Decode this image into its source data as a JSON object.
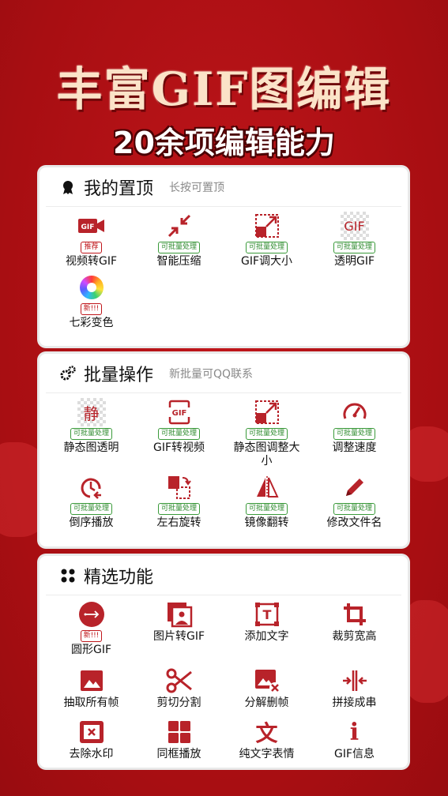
{
  "hero": {
    "title": "丰富GIF图编辑",
    "subtitle": "20余项编辑能力"
  },
  "colors": {
    "brand_red": "#c0161b",
    "icon_red": "#b8232a",
    "badge_green": "#2d8a2d",
    "background": "#b01014"
  },
  "pinned": {
    "title": "我的置顶",
    "hint": "长按可置顶",
    "items": [
      {
        "icon": "video-gif-icon",
        "badge": "推荐",
        "label": "视频转GIF"
      },
      {
        "icon": "compress-icon",
        "badge": "可批量处理",
        "label": "智能压缩"
      },
      {
        "icon": "resize-icon",
        "badge": "可批量处理",
        "label": "GIF调大小"
      },
      {
        "icon": "transparent-gif-icon",
        "icon_text": "GIF",
        "badge": "可批量处理",
        "label": "透明GIF"
      },
      {
        "icon": "color-wheel-icon",
        "badge": "新!!!",
        "label": "七彩变色"
      }
    ]
  },
  "batch": {
    "title": "批量操作",
    "hint": "新批量可QQ联系",
    "items": [
      {
        "icon": "static-transparent-icon",
        "icon_text": "静",
        "badge": "可批量处理",
        "label": "静态图透明"
      },
      {
        "icon": "gif-to-video-icon",
        "icon_text": "GIF",
        "badge": "可批量处理",
        "label": "GIF转视频"
      },
      {
        "icon": "static-resize-icon",
        "badge": "可批量处理",
        "label": "静态图调整大小"
      },
      {
        "icon": "speedometer-icon",
        "badge": "可批量处理",
        "label": "调整速度"
      },
      {
        "icon": "reverse-play-icon",
        "badge": "可批量处理",
        "label": "倒序播放"
      },
      {
        "icon": "rotate-icon",
        "badge": "可批量处理",
        "label": "左右旋转"
      },
      {
        "icon": "mirror-flip-icon",
        "badge": "可批量处理",
        "label": "镜像翻转"
      },
      {
        "icon": "pencil-icon",
        "badge": "可批量处理",
        "label": "修改文件名"
      }
    ]
  },
  "featured": {
    "title": "精选功能",
    "items": [
      {
        "icon": "circle-gif-icon",
        "badge": "新!!!",
        "label": "圆形GIF"
      },
      {
        "icon": "images-icon",
        "label": "图片转GIF"
      },
      {
        "icon": "add-text-icon",
        "icon_text": "T",
        "label": "添加文字"
      },
      {
        "icon": "crop-icon",
        "label": "裁剪宽高"
      },
      {
        "icon": "image-frame-icon",
        "label": "抽取所有帧"
      },
      {
        "icon": "scissors-icon",
        "label": "剪切分割"
      },
      {
        "icon": "delete-frame-icon",
        "label": "分解删帧"
      },
      {
        "icon": "join-icon",
        "label": "拼接成串"
      },
      {
        "icon": "remove-watermark-icon",
        "label": "去除水印"
      },
      {
        "icon": "grid-play-icon",
        "label": "同框播放"
      },
      {
        "icon": "text-sticker-icon",
        "icon_text": "文",
        "label": "纯文字表情"
      },
      {
        "icon": "info-icon",
        "icon_text": "i",
        "label": "GIF信息"
      }
    ]
  }
}
